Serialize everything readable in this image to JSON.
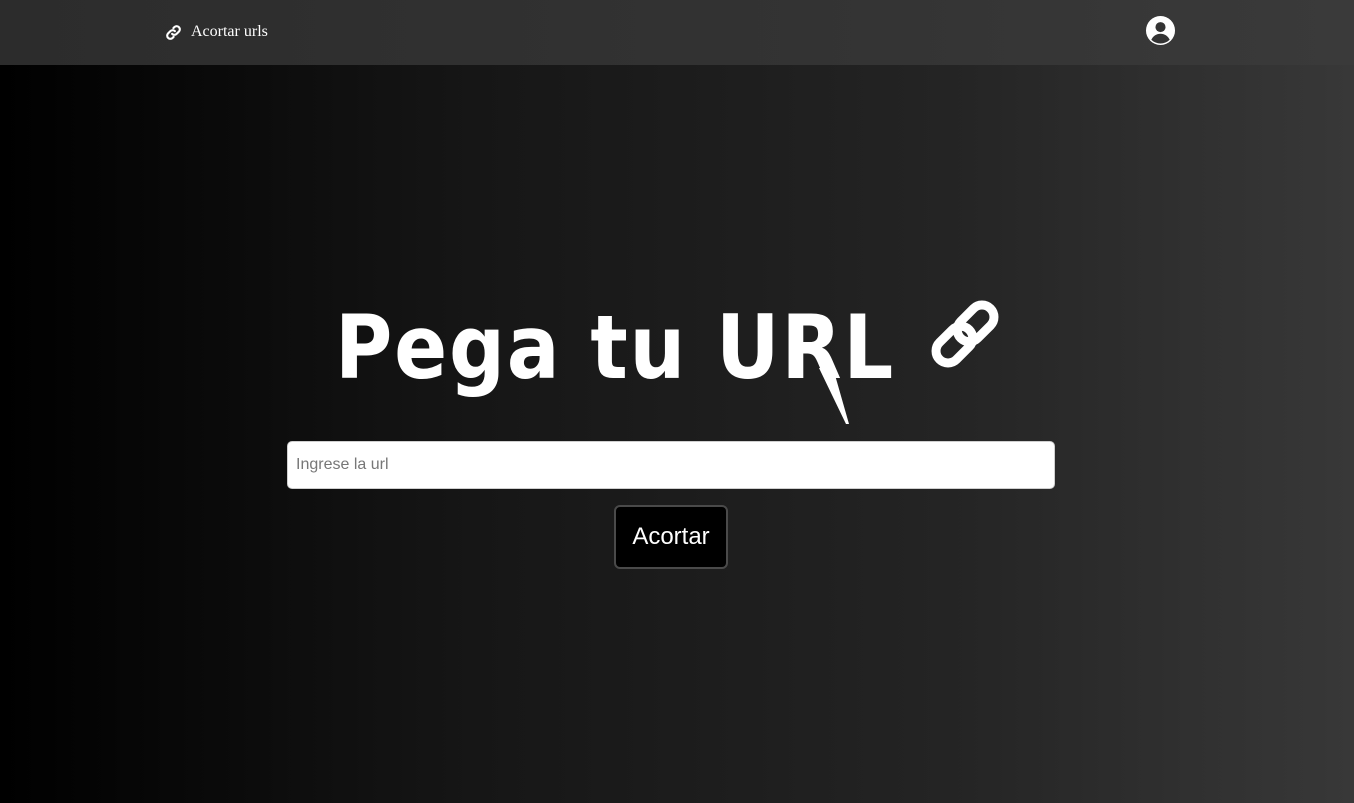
{
  "navbar": {
    "brand_label": "Acortar urls",
    "brand_icon": "link-icon",
    "user_icon": "user-circle-icon"
  },
  "hero": {
    "title": "Pega tu URL",
    "title_icon": "link-icon"
  },
  "form": {
    "url_placeholder": "Ingrese la url",
    "url_value": "",
    "submit_label": "Acortar"
  },
  "colors": {
    "navbar_bg": "#333333",
    "button_bg": "#000000",
    "text": "#ffffff"
  }
}
